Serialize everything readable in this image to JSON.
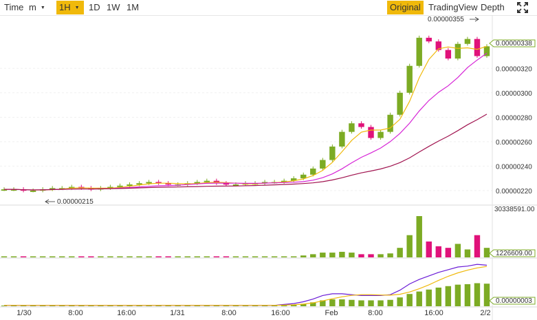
{
  "toolbar": {
    "time_label": "Time",
    "interval_select": "m",
    "interval_active": "1H",
    "intervals": [
      "1D",
      "1W",
      "1M"
    ],
    "views": [
      "Original",
      "TradingView",
      "Depth"
    ],
    "active_view": "Original"
  },
  "icons": {
    "fullscreen": "expand-icon",
    "dropdown": "caret-down-icon"
  },
  "colors": {
    "up": "#7cab24",
    "down": "#e0127a",
    "ma_short": "#f0b90b",
    "ma_mid": "#d623d6",
    "ma_long": "#a0134f",
    "line_purple": "#6a1bd6",
    "accent": "#f0b90b"
  },
  "chart_data": {
    "type": "candlestick",
    "price_axis_labels": [
      "0.00000320",
      "0.00000300",
      "0.00000280",
      "0.00000260",
      "0.00000240",
      "0.00000220"
    ],
    "last_price_label": "0.00000338",
    "high_annotation": "0.00000355",
    "low_annotation": "0.00000215",
    "ylim": [
      2.16e-06,
      3.59e-06
    ],
    "volume_axis_labels": [
      "30338591.00"
    ],
    "volume_last_label": "1226609.00",
    "indicator_last_label": "0.00000003",
    "x_tick_labels": [
      "1/30",
      "8:00",
      "16:00",
      "1/31",
      "8:00",
      "16:00",
      "Feb",
      "8:00",
      "16:00",
      "2/2"
    ],
    "candles_close": [
      2.21e-06,
      2.21e-06,
      2.2e-06,
      2.2e-06,
      2.21e-06,
      2.22e-06,
      2.22e-06,
      2.23e-06,
      2.22e-06,
      2.21e-06,
      2.22e-06,
      2.23e-06,
      2.24e-06,
      2.25e-06,
      2.26e-06,
      2.27e-06,
      2.26e-06,
      2.25e-06,
      2.25e-06,
      2.26e-06,
      2.27e-06,
      2.28e-06,
      2.26e-06,
      2.25e-06,
      2.25e-06,
      2.26e-06,
      2.26e-06,
      2.27e-06,
      2.27e-06,
      2.28e-06,
      2.3e-06,
      2.33e-06,
      2.38e-06,
      2.45e-06,
      2.56e-06,
      2.68e-06,
      2.75e-06,
      2.72e-06,
      2.63e-06,
      2.68e-06,
      2.82e-06,
      3e-06,
      3.22e-06,
      3.45e-06,
      3.42e-06,
      3.35e-06,
      3.28e-06,
      3.4e-06,
      3.44e-06,
      3.3e-06,
      3.38e-06
    ],
    "volume": [
      0.3,
      0.3,
      0.3,
      0.3,
      0.3,
      0.3,
      0.3,
      0.3,
      0.3,
      0.3,
      0.3,
      0.3,
      0.3,
      0.3,
      0.3,
      0.3,
      0.3,
      0.3,
      0.3,
      0.3,
      0.3,
      0.3,
      0.3,
      0.3,
      0.3,
      0.3,
      0.3,
      0.3,
      0.3,
      0.4,
      0.6,
      1.2,
      2.0,
      3.0,
      3.0,
      3.5,
      3.0,
      2.0,
      2.0,
      2.0,
      2.5,
      6.0,
      14.0,
      26.0,
      10.0,
      7.0,
      6.0,
      8.5,
      5.0,
      14.0,
      6.0
    ],
    "volume_max": 30.34,
    "indicator": [
      1,
      1,
      1,
      1,
      1,
      1,
      1,
      1,
      1,
      1,
      1,
      1,
      1,
      1,
      1,
      1,
      1,
      1,
      1,
      1,
      1,
      1,
      1,
      1,
      1,
      1,
      1,
      1,
      1,
      2,
      3,
      5,
      8,
      12,
      14,
      14,
      13,
      12,
      12,
      12,
      13,
      18,
      25,
      30,
      34,
      38,
      41,
      44,
      45,
      47,
      46
    ]
  }
}
